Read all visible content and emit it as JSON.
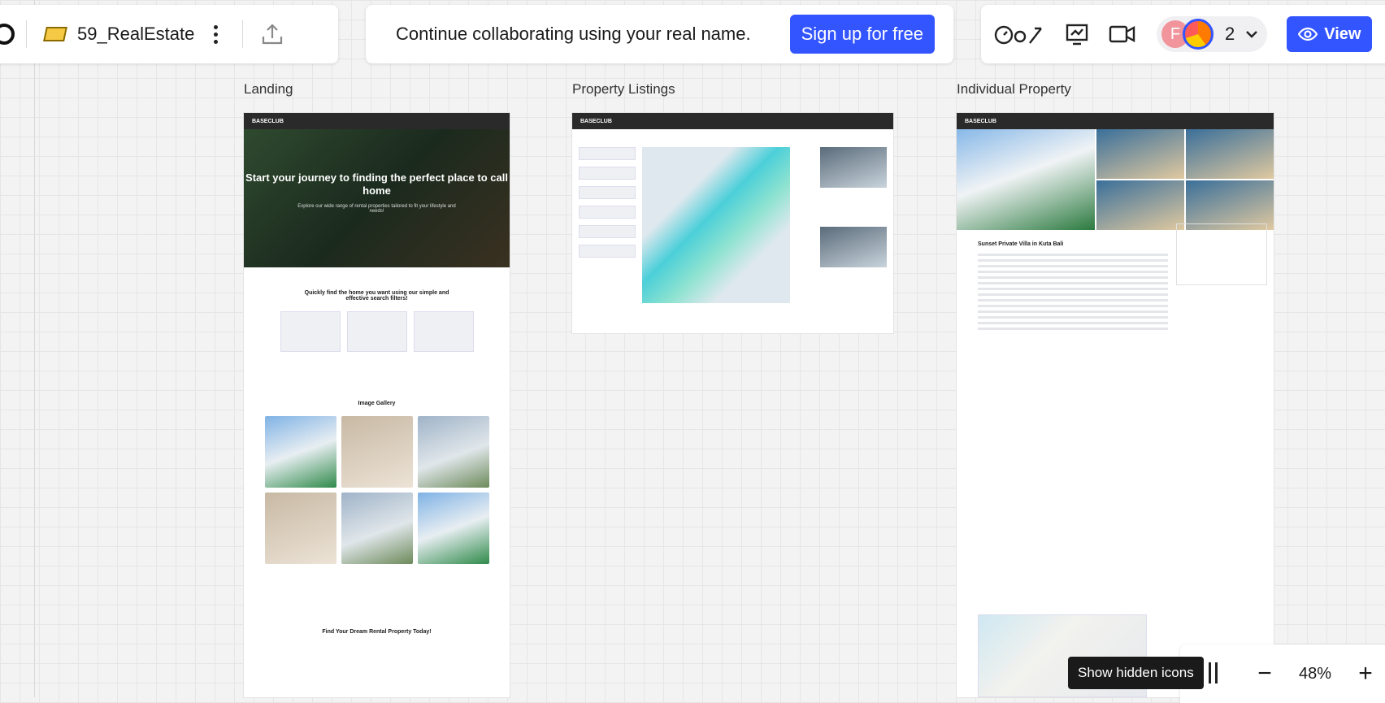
{
  "toolbar": {
    "board_title": "59_RealEstate",
    "collab_message": "Continue collaborating using your real name.",
    "signup_label": "Sign up for free",
    "avatar_initial": "F",
    "collaborator_count": "2",
    "view_label": "View"
  },
  "frames": [
    {
      "label": "Landing"
    },
    {
      "label": "Property Listings"
    },
    {
      "label": "Individual Property"
    }
  ],
  "landing": {
    "logo": "BASECLUB",
    "hero_title": "Start your journey to finding the perfect place to call home",
    "hero_sub": "Explore our wide range of rental properties tailored to fit your lifestyle and needs!",
    "search_title": "Quickly find the home you want using our simple and effective search filters!",
    "gallery_title": "Image Gallery",
    "footer_title": "Find Your Dream Rental Property Today!"
  },
  "individual": {
    "title": "Sunset Private Villa in Kuta Bali"
  },
  "zoom": {
    "level": "48%",
    "tooltip": "Show hidden icons"
  }
}
